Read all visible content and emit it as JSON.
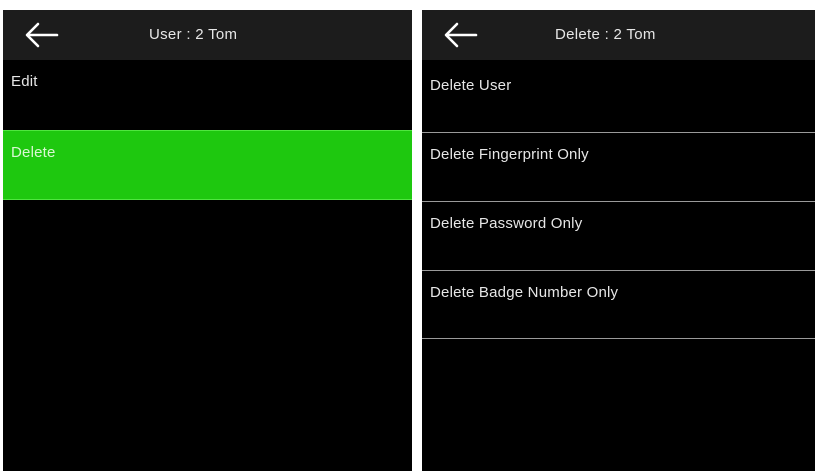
{
  "left_screen": {
    "title": "User : 2 Tom",
    "back_icon": "arrow-left-icon",
    "items": [
      {
        "label": "Edit",
        "selected": false
      },
      {
        "label": "Delete",
        "selected": true
      }
    ]
  },
  "right_screen": {
    "title": "Delete : 2 Tom",
    "back_icon": "arrow-left-icon",
    "items": [
      {
        "label": "Delete User"
      },
      {
        "label": "Delete Fingerprint Only"
      },
      {
        "label": "Delete Password Only"
      },
      {
        "label": "Delete Badge Number Only"
      }
    ]
  },
  "colors": {
    "background": "#000000",
    "title_bar": "#1c1c1c",
    "highlight": "#1ec80f",
    "divider": "#9a9a9a",
    "text": "#e6e6e6"
  }
}
